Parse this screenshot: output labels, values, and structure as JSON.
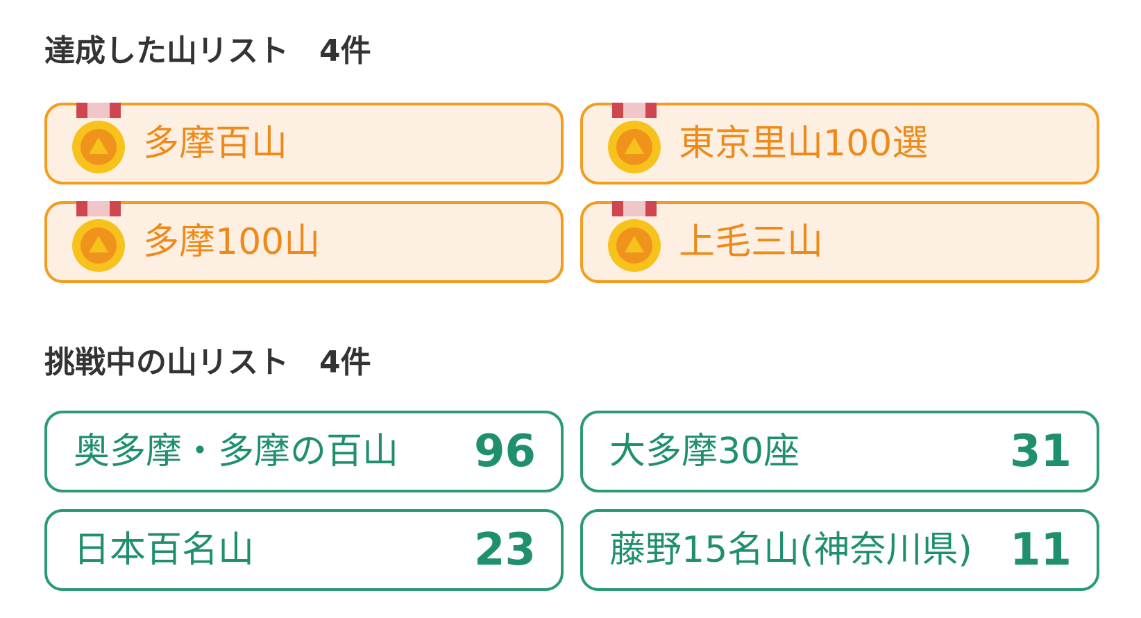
{
  "achieved": {
    "title": "達成した山リスト",
    "count_label": "4件",
    "items": [
      {
        "label": "多摩百山",
        "icon": "medal-icon"
      },
      {
        "label": "東京里山100選",
        "icon": "medal-icon"
      },
      {
        "label": "多摩100山",
        "icon": "medal-icon"
      },
      {
        "label": "上毛三山",
        "icon": "medal-icon"
      }
    ]
  },
  "challenge": {
    "title": "挑戦中の山リスト",
    "count_label": "4件",
    "items": [
      {
        "label": "奥多摩・多摩の百山",
        "count": "96"
      },
      {
        "label": "大多摩30座",
        "count": "31"
      },
      {
        "label": "日本百名山",
        "count": "23"
      },
      {
        "label": "藤野15名山(神奈川県)",
        "count": "11"
      }
    ]
  },
  "colors": {
    "achieved_border": "#f39c1f",
    "achieved_bg": "#fdf0e3",
    "achieved_text": "#ee8a1a",
    "challenge_border": "#2a9a79",
    "challenge_text": "#1f8f6e",
    "heading_text": "#333333",
    "medal_gold": "#f7c21b",
    "medal_inner": "#f0931c",
    "ribbon_red": "#d0464e",
    "ribbon_pink": "#f1c6c8"
  }
}
